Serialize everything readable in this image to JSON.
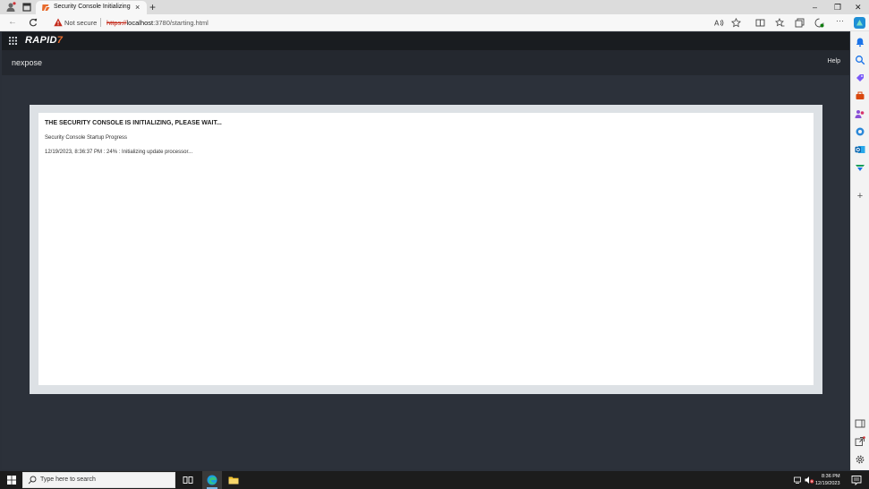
{
  "browser": {
    "tab": {
      "title": "Security Console Initializing"
    },
    "address": {
      "security_label": "Not secure",
      "url_scheme": "https://",
      "url_host": "localhost",
      "url_rest": ":3780/starting.html"
    }
  },
  "app": {
    "logo_text": "RAPID",
    "brand": "nexpose",
    "help_label": "Help",
    "accent_color": "#e86a2c"
  },
  "status": {
    "heading": "THE SECURITY CONSOLE IS INITIALIZING, PLEASE WAIT...",
    "subheading": "Security Console Startup Progress",
    "log_line": "12/19/2023, 8:36:37 PM : 24% : Initializing update processor..."
  },
  "taskbar": {
    "search_placeholder": "Type here to search",
    "time": "8:36 PM",
    "date": "12/19/2023"
  }
}
